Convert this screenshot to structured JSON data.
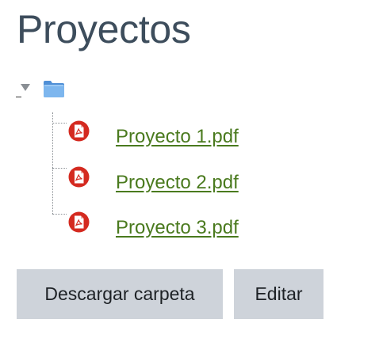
{
  "page": {
    "title": "Proyectos"
  },
  "folder": {
    "files": [
      {
        "name": "Proyecto 1.pdf",
        "icon": "pdf-file-icon"
      },
      {
        "name": "Proyecto 2.pdf",
        "icon": "pdf-file-icon"
      },
      {
        "name": "Proyecto 3.pdf",
        "icon": "pdf-file-icon"
      }
    ]
  },
  "actions": {
    "download_label": "Descargar carpeta",
    "edit_label": "Editar"
  },
  "colors": {
    "title": "#3d4d5c",
    "link": "#4a7a1e",
    "pdf_icon": "#d42a20",
    "button_bg": "#ced3da",
    "folder": "#6aa8e8"
  }
}
